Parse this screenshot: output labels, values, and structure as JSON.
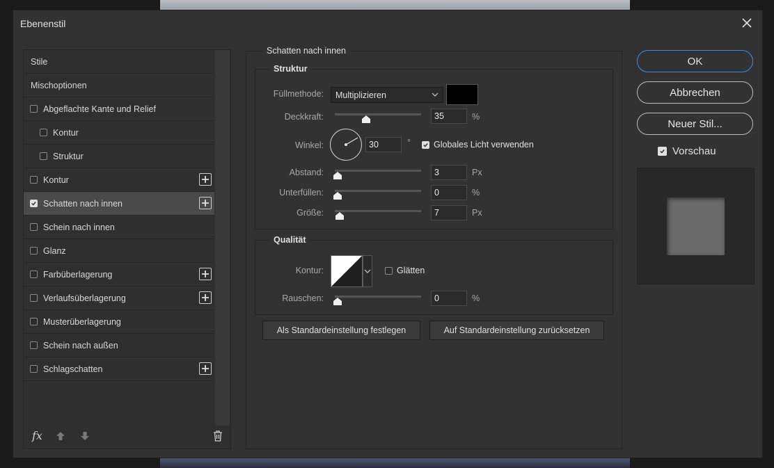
{
  "dialog": {
    "title": "Ebenenstil"
  },
  "styles": {
    "items": [
      {
        "label": "Stile",
        "type": "header"
      },
      {
        "label": "Mischoptionen",
        "type": "header"
      },
      {
        "label": "Abgeflachte Kante und Relief",
        "checked": false,
        "plus": false
      },
      {
        "label": "Kontur",
        "checked": false,
        "plus": false,
        "sub": true
      },
      {
        "label": "Struktur",
        "checked": false,
        "plus": false,
        "sub": true
      },
      {
        "label": "Kontur",
        "checked": false,
        "plus": true
      },
      {
        "label": "Schatten nach innen",
        "checked": true,
        "plus": true,
        "selected": true
      },
      {
        "label": "Schein nach innen",
        "checked": false,
        "plus": false
      },
      {
        "label": "Glanz",
        "checked": false,
        "plus": false
      },
      {
        "label": "Farbüberlagerung",
        "checked": false,
        "plus": true
      },
      {
        "label": "Verlaufsüberlagerung",
        "checked": false,
        "plus": true
      },
      {
        "label": "Musterüberlagerung",
        "checked": false,
        "plus": false
      },
      {
        "label": "Schein nach außen",
        "checked": false,
        "plus": false
      },
      {
        "label": "Schlagschatten",
        "checked": false,
        "plus": true
      }
    ],
    "footer": {
      "fx_label": "fx"
    }
  },
  "inner_shadow": {
    "title": "Schatten nach innen",
    "structure": {
      "title": "Struktur",
      "blend_mode_label": "Füllmethode:",
      "blend_mode_value": "Multiplizieren",
      "color": "#000000",
      "opacity_label": "Deckkraft:",
      "opacity_value": "35",
      "opacity_unit": "%",
      "opacity_fraction": 0.35,
      "angle_label": "Winkel:",
      "angle_value": "30",
      "angle_unit": "°",
      "global_light_label": "Globales Licht verwenden",
      "global_light_checked": true,
      "distance_label": "Abstand:",
      "distance_value": "3",
      "distance_unit": "Px",
      "distance_fraction": 0.0,
      "choke_label": "Unterfüllen:",
      "choke_value": "0",
      "choke_unit": "%",
      "choke_fraction": 0.0,
      "size_label": "Größe:",
      "size_value": "7",
      "size_unit": "Px",
      "size_fraction": 0.03
    },
    "quality": {
      "title": "Qualität",
      "contour_label": "Kontur:",
      "antialias_label": "Glätten",
      "antialias_checked": false,
      "noise_label": "Rauschen:",
      "noise_value": "0",
      "noise_unit": "%",
      "noise_fraction": 0.0
    },
    "buttons": {
      "make_default": "Als Standardeinstellung festlegen",
      "reset_default": "Auf Standardeinstellung zurücksetzen"
    }
  },
  "actions": {
    "ok": "OK",
    "cancel": "Abbrechen",
    "new_style": "Neuer Stil...",
    "preview_label": "Vorschau",
    "preview_checked": true
  },
  "colors": {
    "accent": "#3b8cf0",
    "dialog_bg": "#323232"
  }
}
